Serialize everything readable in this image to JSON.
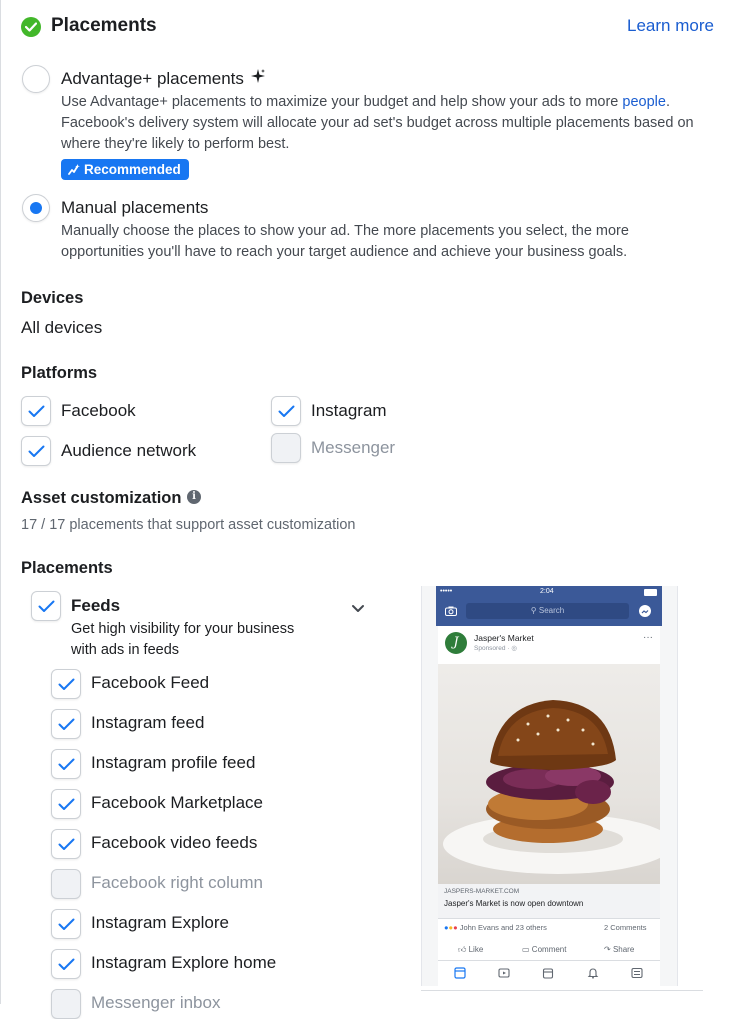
{
  "header": {
    "title": "Placements",
    "learn_more": "Learn more"
  },
  "advantage": {
    "title": "Advantage+ placements",
    "desc_prefix": "Use Advantage+ placements to maximize your budget and help show your ads to more ",
    "desc_link": "people",
    "desc_suffix": ".",
    "desc_line2": "Facebook's delivery system will allocate your ad set's budget across multiple placements based on",
    "desc_line3": "where they're likely to perform best.",
    "badge": "Recommended",
    "selected": false
  },
  "manual": {
    "title": "Manual placements",
    "desc_line1": "Manually choose the places to show your ad. The more placements you select, the more",
    "desc_line2": "opportunities you'll have to reach your target audience and achieve your business goals.",
    "selected": true
  },
  "devices": {
    "label": "Devices",
    "value": "All devices"
  },
  "platforms": {
    "label": "Platforms",
    "items": [
      {
        "label": "Facebook",
        "checked": true
      },
      {
        "label": "Instagram",
        "checked": true
      },
      {
        "label": "Audience network",
        "checked": true
      },
      {
        "label": "Messenger",
        "checked": false
      }
    ]
  },
  "asset": {
    "label": "Asset customization",
    "summary": "17 / 17 placements that support asset customization"
  },
  "placements": {
    "label": "Placements",
    "group": {
      "title": "Feeds",
      "desc_line1": "Get high visibility for your business",
      "desc_line2": "with ads in feeds",
      "checked": true
    },
    "items": [
      {
        "label": "Facebook Feed",
        "checked": true
      },
      {
        "label": "Instagram feed",
        "checked": true
      },
      {
        "label": "Instagram profile feed",
        "checked": true
      },
      {
        "label": "Facebook Marketplace",
        "checked": true
      },
      {
        "label": "Facebook video feeds",
        "checked": true
      },
      {
        "label": "Facebook right column",
        "checked": false
      },
      {
        "label": "Instagram Explore",
        "checked": true
      },
      {
        "label": "Instagram Explore home",
        "checked": true
      },
      {
        "label": "Messenger inbox",
        "checked": false
      }
    ]
  },
  "preview": {
    "time": "2:04",
    "carrier": "•••••",
    "search_placeholder": "Search",
    "page_name": "Jasper's Market",
    "sponsored": "Sponsored · ",
    "logo_letter": "J",
    "link_url": "JASPERS-MARKET.COM",
    "link_title": "Jasper's Market is now open downtown",
    "reactions": "John Evans and 23 others",
    "comments": "2 Comments",
    "like": "Like",
    "comment": "Comment",
    "share": "Share"
  },
  "colors": {
    "accent": "#1877f2",
    "link": "#1a5dd0",
    "success": "#42b72a",
    "fb_header": "#3b5998"
  }
}
